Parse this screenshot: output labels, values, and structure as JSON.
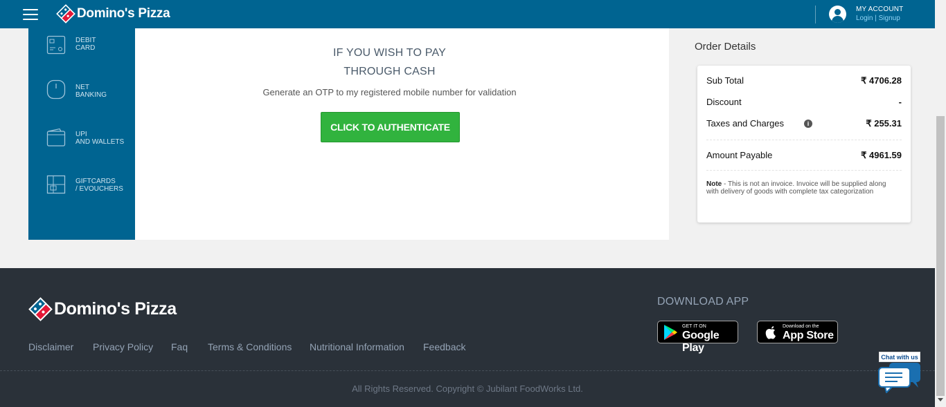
{
  "header": {
    "brand": "Domino's Pizza",
    "account_title": "MY ACCOUNT",
    "login_label": "Login",
    "link_separator": "|",
    "signup_label": "Signup"
  },
  "payment_methods": [
    {
      "line1": "DEBIT",
      "line2": "CARD",
      "icon": "debit-card-icon"
    },
    {
      "line1": "NET",
      "line2": "BANKING",
      "icon": "net-banking-icon"
    },
    {
      "line1": "UPI",
      "line2": "AND WALLETS",
      "icon": "wallet-icon"
    },
    {
      "line1": "GIFTCARDS",
      "line2": "/ EVOUCHERS",
      "icon": "giftcard-icon"
    }
  ],
  "cash": {
    "title_line1": "IF YOU WISH TO PAY",
    "title_line2": "THROUGH CASH",
    "note": "Generate an OTP to my registered mobile number for validation",
    "button": "CLICK TO AUTHENTICATE"
  },
  "order": {
    "title": "Order Details",
    "sub_total_label": "Sub Total",
    "sub_total_value": "₹ 4706.28",
    "discount_label": "Discount",
    "discount_value": "-",
    "taxes_label": "Taxes and Charges",
    "taxes_value": "₹ 255.31",
    "payable_label": "Amount Payable",
    "payable_value": "₹ 4961.59",
    "note_label": "Note",
    "note_text": " - This is not an invoice. Invoice will be supplied along with delivery of goods with complete tax categorization"
  },
  "footer": {
    "brand": "Domino's Pizza",
    "links": [
      "Disclaimer",
      "Privacy Policy",
      "Faq",
      "Terms & Conditions",
      "Nutritional Information",
      "Feedback"
    ],
    "download_title": "DOWNLOAD APP",
    "google_small": "GET IT ON",
    "google_big": "Google Play",
    "apple_small": "Download on the",
    "apple_big": "App Store",
    "copyright": "All Rights Reserved. Copyright © Jubilant FoodWorks Ltd."
  },
  "chat": {
    "label": "Chat with us"
  },
  "colors": {
    "brand_blue": "#006491",
    "accent_green": "#31b33e",
    "footer_bg": "#2a3139",
    "logo_red": "#e31837"
  }
}
